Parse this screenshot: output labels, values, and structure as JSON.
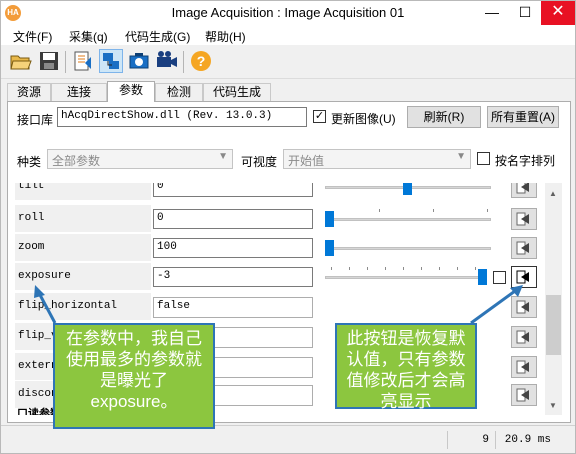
{
  "window": {
    "title": "Image Acquisition : Image Acquisition 01",
    "app_icon_text": "HA",
    "controls": {
      "minimize": "—",
      "maximize": "☐",
      "close": "✕"
    }
  },
  "menu": [
    "文件(F)",
    "采集(q)",
    "代码生成(G)",
    "帮助(H)"
  ],
  "toolbar": {
    "icons": [
      "open-folder-icon",
      "save-disk-icon",
      "open-assistant-icon",
      "connection-icon",
      "snap-camera-icon",
      "live-camcorder-icon",
      "help-icon"
    ],
    "help_glyph": "?"
  },
  "tabs": [
    "资源",
    "连接",
    "参数",
    "检测",
    "代码生成"
  ],
  "active_tab": "参数",
  "interface": {
    "label": "接口库",
    "value": "hAcqDirectShow.dll (Rev. 13.0.3)",
    "update_image_label": "更新图像(U)",
    "update_image_checked": true,
    "refresh_label": "刷新(R)",
    "reset_all_label": "所有重置(A)"
  },
  "filters": {
    "category_label": "种类",
    "category_value": "全部参数",
    "visibility_label": "可视度",
    "visibility_value": "开始值",
    "sort_label": "按名字排列",
    "sort_checked": false
  },
  "parameters": [
    {
      "name": "tilt",
      "value": "0",
      "type": "slider",
      "level": 0.5
    },
    {
      "name": "roll",
      "value": "0",
      "type": "slider",
      "level": 0.0
    },
    {
      "name": "zoom",
      "value": "100",
      "type": "slider",
      "level": 0.0
    },
    {
      "name": "exposure",
      "value": "-3",
      "type": "slider",
      "level": 0.97,
      "has_checkbox": true,
      "reset_enabled": true
    },
    {
      "name": "flip_horizontal",
      "value": "false",
      "type": "combo"
    },
    {
      "name": "flip_vertical",
      "value": "false",
      "type": "combo"
    },
    {
      "name": "external_trigger",
      "value": "",
      "type": "combo"
    },
    {
      "name": "disconnect_graph",
      "value": "false",
      "type": "combo"
    }
  ],
  "cut_off_label": "口读参数",
  "status": {
    "count": "9",
    "time": "20.9 ms"
  },
  "annotations": {
    "left": "在参数中，我自己使用最多的参数就是曝光了exposure。",
    "right": "此按钮是恢复默认值，只有参数值修改后才会高亮显示"
  },
  "colors": {
    "callout_fill": "#8cc63f",
    "callout_border": "#2e75b6",
    "slider_thumb": "#0078d7",
    "close_button": "#e81123"
  }
}
